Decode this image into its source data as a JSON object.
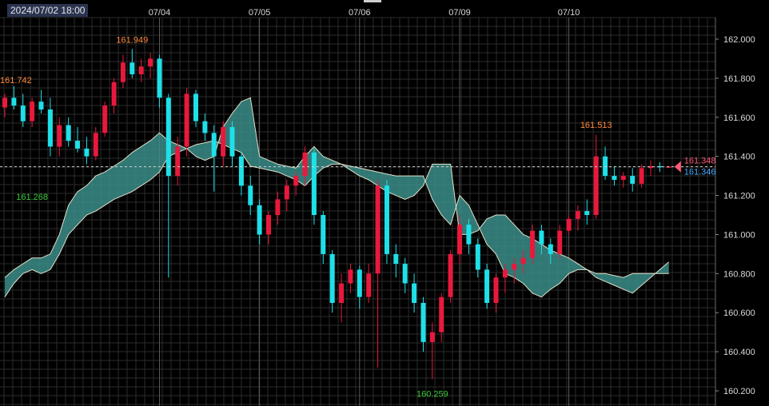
{
  "header": {
    "timestamp": "2024/07/02 18:00"
  },
  "chart_data": {
    "type": "candlestick",
    "title": "",
    "x_labels": [
      {
        "label": "07/04",
        "bar": 17
      },
      {
        "label": "07/05",
        "bar": 28
      },
      {
        "label": "07/06",
        "bar": 39
      },
      {
        "label": "07/09",
        "bar": 50
      },
      {
        "label": "07/10",
        "bar": 62
      }
    ],
    "y_ticks": [
      "162.000",
      "161.800",
      "161.600",
      "161.400",
      "161.200",
      "161.000",
      "160.800",
      "160.600",
      "160.400",
      "160.200"
    ],
    "ylim": [
      160.2,
      162.0
    ],
    "bar_count": 74,
    "colors": {
      "up": "#e8193c",
      "down": "#1ee0e8",
      "cloud": "#3a8c88",
      "span": "#e0e0c8",
      "grid": "#2c2c2c",
      "high_label": "#ff8a3d",
      "low_label": "#39c93a",
      "bid_label": "#ff5a78",
      "ask_label": "#4aa8ff"
    },
    "candles": [
      [
        161.65,
        161.72,
        161.6,
        161.7
      ],
      [
        161.7,
        161.76,
        161.64,
        161.66
      ],
      [
        161.66,
        161.72,
        161.55,
        161.58
      ],
      [
        161.58,
        161.7,
        161.55,
        161.68
      ],
      [
        161.68,
        161.74,
        161.62,
        161.64
      ],
      [
        161.64,
        161.7,
        161.4,
        161.45
      ],
      [
        161.45,
        161.6,
        161.4,
        161.56
      ],
      [
        161.56,
        161.6,
        161.45,
        161.48
      ],
      [
        161.48,
        161.55,
        161.42,
        161.44
      ],
      [
        161.44,
        161.5,
        161.36,
        161.4
      ],
      [
        161.4,
        161.55,
        161.38,
        161.52
      ],
      [
        161.52,
        161.68,
        161.5,
        161.66
      ],
      [
        161.66,
        161.8,
        161.62,
        161.78
      ],
      [
        161.78,
        161.92,
        161.75,
        161.88
      ],
      [
        161.88,
        161.95,
        161.8,
        161.82
      ],
      [
        161.82,
        161.9,
        161.78,
        161.86
      ],
      [
        161.86,
        161.93,
        161.8,
        161.9
      ],
      [
        161.9,
        161.92,
        161.65,
        161.7
      ],
      [
        161.7,
        161.72,
        160.78,
        161.3
      ],
      [
        161.3,
        161.5,
        161.25,
        161.45
      ],
      [
        161.45,
        161.75,
        161.4,
        161.72
      ],
      [
        161.72,
        161.74,
        161.55,
        161.58
      ],
      [
        161.58,
        161.62,
        161.48,
        161.52
      ],
      [
        161.52,
        161.56,
        161.22,
        161.4
      ],
      [
        161.4,
        161.58,
        161.35,
        161.55
      ],
      [
        161.55,
        161.58,
        161.35,
        161.4
      ],
      [
        161.4,
        161.42,
        161.2,
        161.25
      ],
      [
        161.25,
        161.3,
        161.1,
        161.15
      ],
      [
        161.15,
        161.18,
        160.95,
        161.0
      ],
      [
        161.0,
        161.12,
        160.95,
        161.1
      ],
      [
        161.1,
        161.22,
        161.05,
        161.18
      ],
      [
        161.18,
        161.28,
        161.12,
        161.25
      ],
      [
        161.25,
        161.32,
        161.2,
        161.3
      ],
      [
        161.3,
        161.45,
        161.25,
        161.42
      ],
      [
        161.42,
        161.44,
        161.05,
        161.1
      ],
      [
        161.1,
        161.12,
        160.85,
        160.9
      ],
      [
        160.9,
        160.92,
        160.6,
        160.65
      ],
      [
        160.65,
        160.8,
        160.55,
        160.75
      ],
      [
        160.75,
        160.85,
        160.7,
        160.82
      ],
      [
        160.82,
        160.84,
        160.62,
        160.68
      ],
      [
        160.68,
        160.85,
        160.65,
        160.8
      ],
      [
        160.8,
        161.28,
        160.32,
        161.25
      ],
      [
        161.25,
        161.28,
        160.85,
        160.9
      ],
      [
        160.9,
        160.95,
        160.78,
        160.85
      ],
      [
        160.85,
        160.88,
        160.7,
        160.75
      ],
      [
        160.75,
        160.8,
        160.6,
        160.65
      ],
      [
        160.65,
        160.68,
        160.4,
        160.45
      ],
      [
        160.45,
        160.55,
        160.26,
        160.5
      ],
      [
        160.5,
        160.7,
        160.45,
        160.68
      ],
      [
        160.68,
        160.92,
        160.65,
        160.9
      ],
      [
        160.9,
        161.1,
        160.85,
        161.05
      ],
      [
        161.05,
        161.08,
        160.9,
        160.95
      ],
      [
        160.95,
        160.98,
        160.78,
        160.82
      ],
      [
        160.82,
        160.85,
        160.62,
        160.65
      ],
      [
        160.65,
        160.8,
        160.6,
        160.78
      ],
      [
        160.78,
        160.85,
        160.7,
        160.82
      ],
      [
        160.82,
        160.88,
        160.75,
        160.85
      ],
      [
        160.85,
        160.92,
        160.8,
        160.88
      ],
      [
        160.88,
        161.05,
        160.85,
        161.02
      ],
      [
        161.02,
        161.05,
        160.9,
        160.95
      ],
      [
        160.95,
        160.98,
        160.85,
        160.9
      ],
      [
        160.9,
        161.05,
        160.88,
        161.02
      ],
      [
        161.02,
        161.1,
        161.0,
        161.08
      ],
      [
        161.08,
        161.15,
        161.02,
        161.12
      ],
      [
        161.12,
        161.18,
        161.05,
        161.1
      ],
      [
        161.1,
        161.51,
        161.08,
        161.4
      ],
      [
        161.4,
        161.45,
        161.28,
        161.3
      ],
      [
        161.3,
        161.35,
        161.25,
        161.28
      ],
      [
        161.28,
        161.32,
        161.24,
        161.3
      ],
      [
        161.3,
        161.34,
        161.22,
        161.26
      ],
      [
        161.26,
        161.36,
        161.24,
        161.34
      ],
      [
        161.34,
        161.38,
        161.3,
        161.35
      ],
      [
        161.35,
        161.37,
        161.32,
        161.346
      ],
      [
        161.346,
        161.35,
        161.34,
        161.348
      ]
    ],
    "cloud": {
      "upper": [
        160.78,
        160.82,
        160.85,
        160.88,
        160.88,
        160.9,
        161.0,
        161.15,
        161.22,
        161.25,
        161.3,
        161.32,
        161.35,
        161.38,
        161.42,
        161.45,
        161.48,
        161.52,
        161.48,
        161.46,
        161.44,
        161.4,
        161.38,
        161.4,
        161.55,
        161.62,
        161.68,
        161.7,
        161.4,
        161.38,
        161.36,
        161.35,
        161.34,
        161.4,
        161.45,
        161.4,
        161.38,
        161.36,
        161.33,
        161.3,
        161.28,
        161.25,
        161.22,
        161.2,
        161.18,
        161.2,
        161.25,
        161.36,
        161.36,
        161.36,
        161.0,
        161.0,
        161.02,
        161.08,
        161.1,
        161.1,
        161.05,
        161.0,
        160.98,
        160.95,
        160.92,
        160.9,
        160.88,
        160.85,
        160.82,
        160.78,
        160.76,
        160.74,
        160.72,
        160.7,
        160.74,
        160.78,
        160.82,
        160.86
      ],
      "lower": [
        160.68,
        160.75,
        160.8,
        160.82,
        160.8,
        160.82,
        160.9,
        161.0,
        161.05,
        161.1,
        161.12,
        161.15,
        161.18,
        161.2,
        161.22,
        161.25,
        161.28,
        161.32,
        161.4,
        161.42,
        161.44,
        161.46,
        161.47,
        161.48,
        161.46,
        161.44,
        161.42,
        161.35,
        161.34,
        161.33,
        161.32,
        161.3,
        161.28,
        161.25,
        161.3,
        161.34,
        161.36,
        161.36,
        161.35,
        161.34,
        161.33,
        161.32,
        161.31,
        161.3,
        161.3,
        161.3,
        161.3,
        161.18,
        161.1,
        161.05,
        161.2,
        161.15,
        161.05,
        160.95,
        160.9,
        160.8,
        160.78,
        160.75,
        160.7,
        160.68,
        160.72,
        160.75,
        160.8,
        160.82,
        160.82,
        160.8,
        160.8,
        160.79,
        160.78,
        160.8,
        160.8,
        160.8,
        160.8,
        160.8
      ]
    },
    "annotations": [
      {
        "text": "161.949",
        "bar": 14,
        "value": 161.949,
        "kind": "high"
      },
      {
        "text": "161.742",
        "bar": 0,
        "value": 161.742,
        "kind": "high"
      },
      {
        "text": "161.268",
        "bar": 3,
        "value": 161.268,
        "kind": "low"
      },
      {
        "text": "160.259",
        "bar": 47,
        "value": 160.259,
        "kind": "low"
      },
      {
        "text": "161.513",
        "bar": 65,
        "value": 161.513,
        "kind": "high"
      }
    ],
    "current": {
      "bid": "161.348",
      "ask": "161.346",
      "value": 161.347
    }
  }
}
